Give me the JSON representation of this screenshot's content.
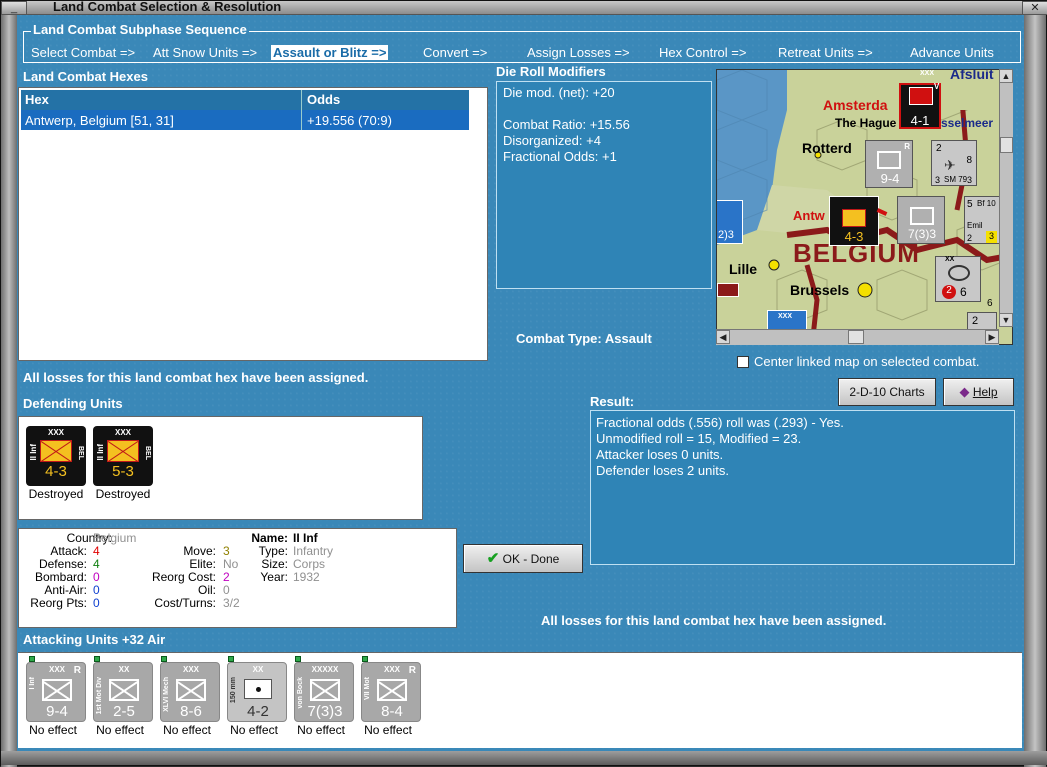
{
  "window": {
    "title": "Land Combat Selection & Resolution",
    "min_glyph": "_",
    "close_glyph": "✕"
  },
  "phases": {
    "title": "Land Combat Subphase Sequence",
    "items": [
      {
        "label": "Select Combat =>",
        "active": false
      },
      {
        "label": "Att Snow Units =>",
        "active": false
      },
      {
        "label": "Assault or Blitz =>",
        "active": true
      },
      {
        "label": "Convert =>",
        "active": false
      },
      {
        "label": "Assign Losses =>",
        "active": false
      },
      {
        "label": "Hex Control =>",
        "active": false
      },
      {
        "label": "Retreat Units =>",
        "active": false
      },
      {
        "label": "Advance Units",
        "active": false
      }
    ]
  },
  "hexes": {
    "title": "Land Combat Hexes",
    "columns": [
      "Hex",
      "Odds"
    ],
    "rows": [
      {
        "hex": "Antwerp, Belgium [51, 31]",
        "odds": "+19.556 (70:9)"
      }
    ]
  },
  "die_roll": {
    "title": "Die Roll Modifiers",
    "lines": [
      "Die mod. (net): +20",
      "",
      "Combat Ratio: +15.56",
      "Disorganized: +4",
      "Fractional Odds: +1"
    ]
  },
  "combat_type": {
    "label": "Combat Type:",
    "value": "Assault"
  },
  "map": {
    "labels": {
      "afsluit": "Afsluit",
      "amsterdam": "Amsterda",
      "hague": "The Hague",
      "ijsselmeer": "sselmeer",
      "rotterdam": "Rotterd",
      "antwerp": "Antw",
      "belgium": "BELGIUM",
      "lille": "Lille",
      "brussels": "Brussels",
      "sm": "SM 79",
      "bf": "Bf 10",
      "emil": "Emil"
    },
    "counters": {
      "top_dutch": "4-1",
      "infantry_94": "9-4",
      "antwerp_def": "4-3",
      "vonbock": "7(3)3",
      "belgium_aa": "6",
      "belgium_aa_red": "2",
      "edge_left": "2)3",
      "plane_1": "2",
      "plane_8": "8",
      "plane_3a": "3",
      "plane_3b": "3",
      "bf_5": "5",
      "bf_2": "2",
      "bf_3": "3",
      "bottom_2": "2",
      "bottom_6": "6",
      "xxx": "XXX",
      "xx": "XX",
      "r": "R",
      "v": "V"
    },
    "colors": {
      "sea": "#5a96c6",
      "land": "#c9d29a",
      "border": "#8b1a1a"
    }
  },
  "center_map": {
    "label": "Center linked map on selected combat.",
    "checked": false
  },
  "buttons": {
    "charts": "2-D-10 Charts",
    "help": "Help",
    "ok": "OK - Done"
  },
  "status_top": "All losses for this land combat hex have been assigned.",
  "status_bottom": "All losses for this land combat hex have been assigned.",
  "defending": {
    "title": "Defending Units",
    "units": [
      {
        "name": "II Inf",
        "size": "XXX",
        "nation": "BEL",
        "strength": "4-3",
        "status": "Destroyed"
      },
      {
        "name": "II Inf",
        "size": "XXX",
        "nation": "BEL",
        "strength": "5-3",
        "status": "Destroyed"
      }
    ]
  },
  "unit_info": {
    "country_label": "Country:",
    "country": "Belgium",
    "attack_label": "Attack:",
    "attack": "4",
    "defense_label": "Defense:",
    "defense": "4",
    "bombard_label": "Bombard:",
    "bombard": "0",
    "antiair_label": "Anti-Air:",
    "antiair": "0",
    "reorgpts_label": "Reorg Pts:",
    "reorgpts": "0",
    "move_label": "Move:",
    "move": "3",
    "elite_label": "Elite:",
    "elite": "No",
    "reorgcost_label": "Reorg Cost:",
    "reorgcost": "2",
    "oil_label": "Oil:",
    "oil": "0",
    "costturns_label": "Cost/Turns:",
    "costturns": "3/2",
    "name_label": "Name:",
    "name": "II Inf",
    "type_label": "Type:",
    "type": "Infantry",
    "size_label": "Size:",
    "size": "Corps",
    "year_label": "Year:",
    "year": "1932"
  },
  "result": {
    "title": "Result:",
    "lines": [
      "Fractional odds (.556) roll was (.293)  - Yes.",
      "Unmodified roll = 15, Modified = 23.",
      "Attacker loses 0 units.",
      "Defender loses 2 units."
    ]
  },
  "attacking": {
    "title": "Attacking Units +32 Air",
    "units": [
      {
        "name": "I Inf",
        "size": "XXX",
        "strength": "9-4",
        "reserve": "R",
        "status": "No effect"
      },
      {
        "name": "1st Mot Div",
        "size": "XX",
        "strength": "2-5",
        "reserve": "",
        "status": "No effect"
      },
      {
        "name": "XLVI Mech",
        "size": "XXX",
        "strength": "8-6",
        "reserve": "",
        "status": "No effect"
      },
      {
        "name": "150 mm",
        "size": "XX",
        "strength": "4-2",
        "reserve": "",
        "status": "No effect"
      },
      {
        "name": "von Bock",
        "size": "XXXXX",
        "strength": "7(3)3",
        "reserve": "",
        "status": "No effect"
      },
      {
        "name": "VII Mot",
        "size": "XXX",
        "strength": "8-4",
        "reserve": "R",
        "status": "No effect"
      }
    ]
  }
}
